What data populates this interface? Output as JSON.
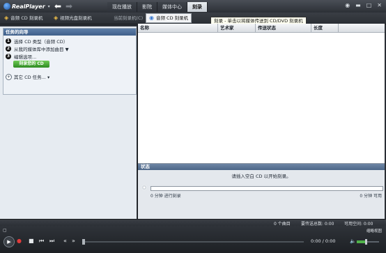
{
  "app": {
    "logo_text": "RealPlayer",
    "logo_dropdown": "▾"
  },
  "nav": {
    "back": "⬅",
    "forward": "➡"
  },
  "tabs": [
    {
      "label": "现在播放"
    },
    {
      "label": "影院"
    },
    {
      "label": "媒体中心"
    },
    {
      "label": "刻录",
      "active": true
    }
  ],
  "window_controls": {
    "toggle": "◉",
    "minimize": "▬",
    "maximize": "□",
    "close": "✕"
  },
  "toolbar": {
    "item1": "音频 CD 刻录机",
    "item2": "视频光盘刻录机",
    "item3": "当前刻录机(C)",
    "item4": "音频 CD 刻录机"
  },
  "tooltip": "刻录 - 单击以将媒体传送到 CD/DVD 刻录机",
  "task_panel": {
    "header": "任务的向导",
    "steps": [
      {
        "num": "1",
        "label": "选择 CD 类型（音频 CD）"
      },
      {
        "num": "2",
        "label": "从我的媒体库中添加曲目 ▼"
      },
      {
        "num": "3",
        "label": "编辑选项..."
      }
    ],
    "burn_button": "刻录您的 CD",
    "other_tasks": "其它 CD 任务... ▾"
  },
  "table": {
    "columns": [
      "名称",
      "艺术家",
      "传送状态",
      "长度"
    ]
  },
  "status": {
    "header": "状态",
    "message": "请插入空白 CD 以开始刻录。",
    "left_label": "0 分钟 进行刻录",
    "right_label": "0 分钟 可用"
  },
  "info_bar": {
    "tracks": "0 个曲目",
    "total_time": "要传送总数: 0:00",
    "free_space": "可用空间: 0:00"
  },
  "playbar": {
    "top_icon": "▢",
    "thumbnail": "缩略视图",
    "play": "▶",
    "record": "●",
    "stop": "■",
    "prev": "⏮",
    "next": "⏭",
    "rewind": "«",
    "forward": "»",
    "time": "0:00 / 0:00",
    "volume_icon": "🔈",
    "volume_level": 0.45
  }
}
